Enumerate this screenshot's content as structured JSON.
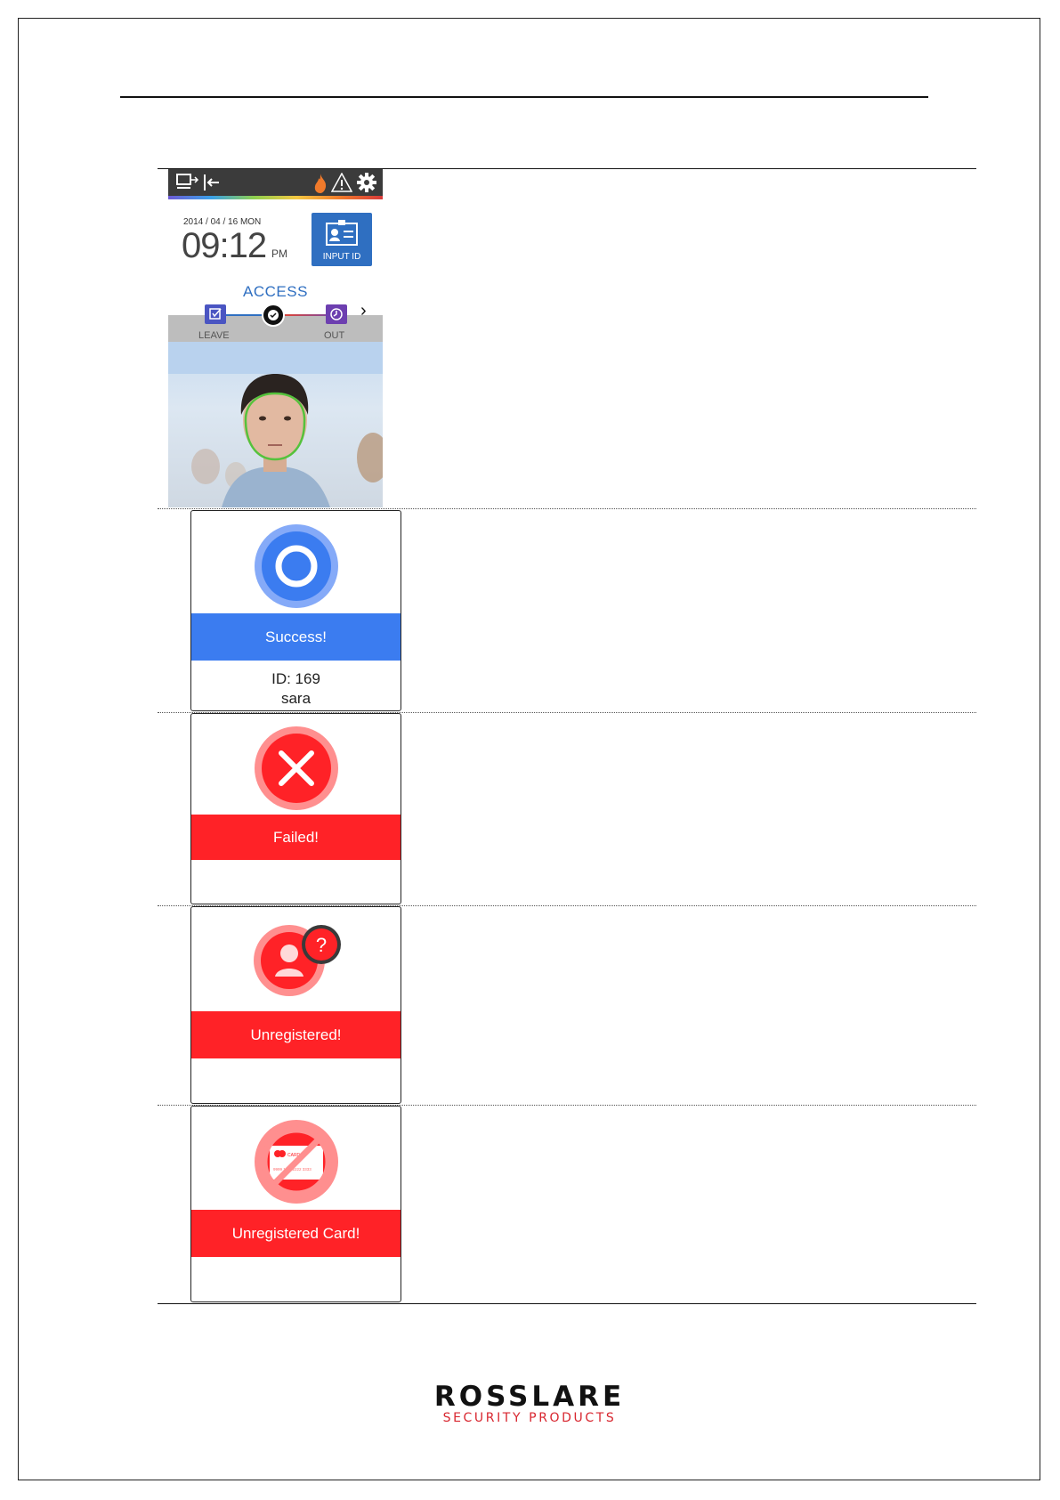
{
  "device_screen": {
    "date": "2014 / 04 / 16 MON",
    "time": "09:12",
    "ampm": "PM",
    "input_id_label": "INPUT ID",
    "mode_label": "ACCESS",
    "mode_left_label": "LEAVE",
    "mode_right_label": "OUT",
    "icons": [
      "monitor-arrow-icon",
      "exit-arrow-icon",
      "fire-icon",
      "warning-icon",
      "gear-icon",
      "id-card-icon",
      "chevron-right-icon"
    ]
  },
  "results": [
    {
      "status": "Success!",
      "id_line": "ID: 169",
      "name_line": "sara",
      "color": "#3b7cf0",
      "icon": "circle-success-icon"
    },
    {
      "status": "Failed!",
      "color": "#ff2227",
      "icon": "x-fail-icon"
    },
    {
      "status": "Unregistered!",
      "color": "#ff2227",
      "icon": "unknown-user-icon"
    },
    {
      "status": "Unregistered Card!",
      "color": "#ff2227",
      "icon": "no-card-icon"
    }
  ],
  "card_graphic_text": {
    "brand": "CARD",
    "number": "9999 1111 2222 3333"
  },
  "footer": {
    "logo_main": "ROSSLARE",
    "logo_sub": "SECURITY PRODUCTS",
    "logo_color": "#d8262f"
  }
}
